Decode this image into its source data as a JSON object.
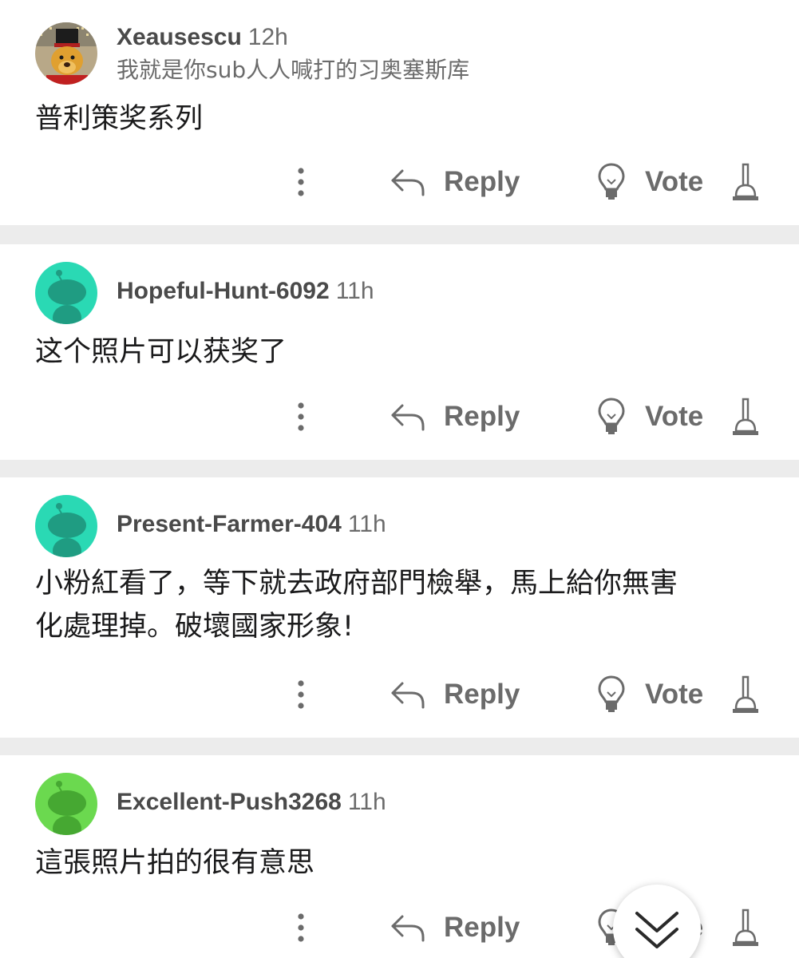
{
  "comments": [
    {
      "username": "Xeausescu",
      "time": "12h",
      "flair": "我就是你sub人人喊打的习奥塞斯库",
      "lines": [
        "普利策奖系列"
      ]
    },
    {
      "username": "Hopeful-Hunt-6092",
      "time": "11h",
      "lines": [
        "这个照片可以获奖了"
      ]
    },
    {
      "username": "Present-Farmer-404",
      "time": "11h",
      "lines": [
        "小粉紅看了，等下就去政府部門檢舉，馬上給你無害",
        "化處理掉。破壞國家形象!"
      ]
    },
    {
      "username": "Excellent-Push3268",
      "time": "11h",
      "lines": [
        "這張照片拍的很有意思"
      ]
    }
  ],
  "actions": {
    "reply_label": "Reply",
    "vote_label": "Vote"
  },
  "icons": {
    "more": "more-vertical-icon",
    "reply": "reply-arrow-icon",
    "vote": "lightbulb-icon",
    "downvote": "plunger-icon",
    "scroll": "double-chevron-down-icon"
  },
  "colors": {
    "background": "#ececec",
    "card": "#ffffff",
    "meta_text": "#6b6b6b",
    "avatar_teal": "#2ad9b4",
    "avatar_green": "#6bd94f"
  }
}
